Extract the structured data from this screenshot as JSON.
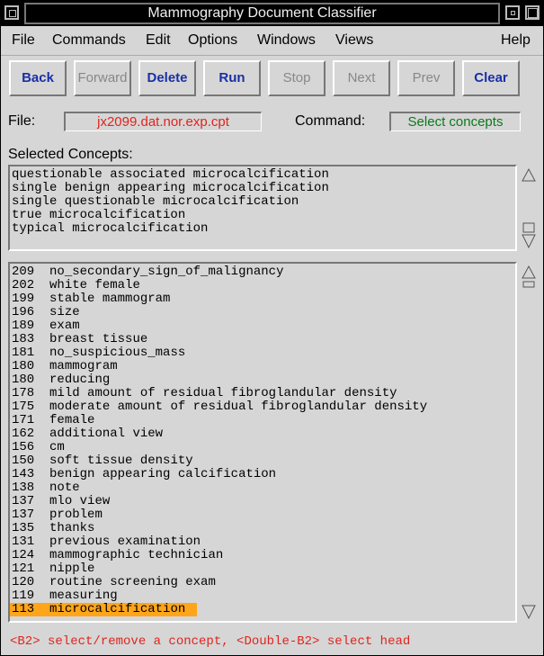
{
  "window": {
    "title": "Mammography Document Classifier"
  },
  "menu": [
    "File",
    "Commands",
    "Edit",
    "Options",
    "Windows",
    "Views",
    "Help"
  ],
  "toolbar": {
    "back": "Back",
    "forward": "Forward",
    "delete": "Delete",
    "run": "Run",
    "stop": "Stop",
    "next": "Next",
    "prev": "Prev",
    "clear": "Clear"
  },
  "file": {
    "label": "File:",
    "value": "jx2099.dat.nor.exp.cpt"
  },
  "command": {
    "label": "Command:",
    "value": "Select concepts"
  },
  "selected": {
    "label": "Selected Concepts:",
    "items": [
      "questionable associated microcalcification",
      "single benign appearing microcalcification",
      "single questionable microcalcification",
      "true microcalcification",
      "typical microcalcification"
    ]
  },
  "concepts": {
    "rows": [
      {
        "count": "209",
        "name": "no_secondary_sign_of_malignancy"
      },
      {
        "count": "202",
        "name": "white female"
      },
      {
        "count": "199",
        "name": "stable mammogram"
      },
      {
        "count": "196",
        "name": "size"
      },
      {
        "count": "189",
        "name": "exam"
      },
      {
        "count": "183",
        "name": "breast tissue"
      },
      {
        "count": "181",
        "name": "no_suspicious_mass"
      },
      {
        "count": "180",
        "name": "mammogram"
      },
      {
        "count": "180",
        "name": "reducing"
      },
      {
        "count": "178",
        "name": "mild amount of residual fibroglandular density"
      },
      {
        "count": "175",
        "name": "moderate amount of residual fibroglandular density"
      },
      {
        "count": "171",
        "name": "female"
      },
      {
        "count": "162",
        "name": "additional view"
      },
      {
        "count": "156",
        "name": "cm"
      },
      {
        "count": "150",
        "name": "soft tissue density"
      },
      {
        "count": "143",
        "name": "benign appearing calcification"
      },
      {
        "count": "138",
        "name": "note"
      },
      {
        "count": "137",
        "name": "mlo view"
      },
      {
        "count": "137",
        "name": "problem"
      },
      {
        "count": "135",
        "name": "thanks"
      },
      {
        "count": "131",
        "name": "previous examination"
      },
      {
        "count": "124",
        "name": "mammographic technician"
      },
      {
        "count": "121",
        "name": "nipple"
      },
      {
        "count": "120",
        "name": "routine screening exam"
      },
      {
        "count": "119",
        "name": "measuring"
      },
      {
        "count": "113",
        "name": "microcalcification"
      }
    ],
    "selected_index": 25
  },
  "status": "<B2> select/remove a concept, <Double-B2> select head",
  "colors": {
    "highlight": "#ffa519",
    "file_value": "#e0241c",
    "command_value": "#0b7a1a",
    "button_text": "#1a2fa6"
  }
}
